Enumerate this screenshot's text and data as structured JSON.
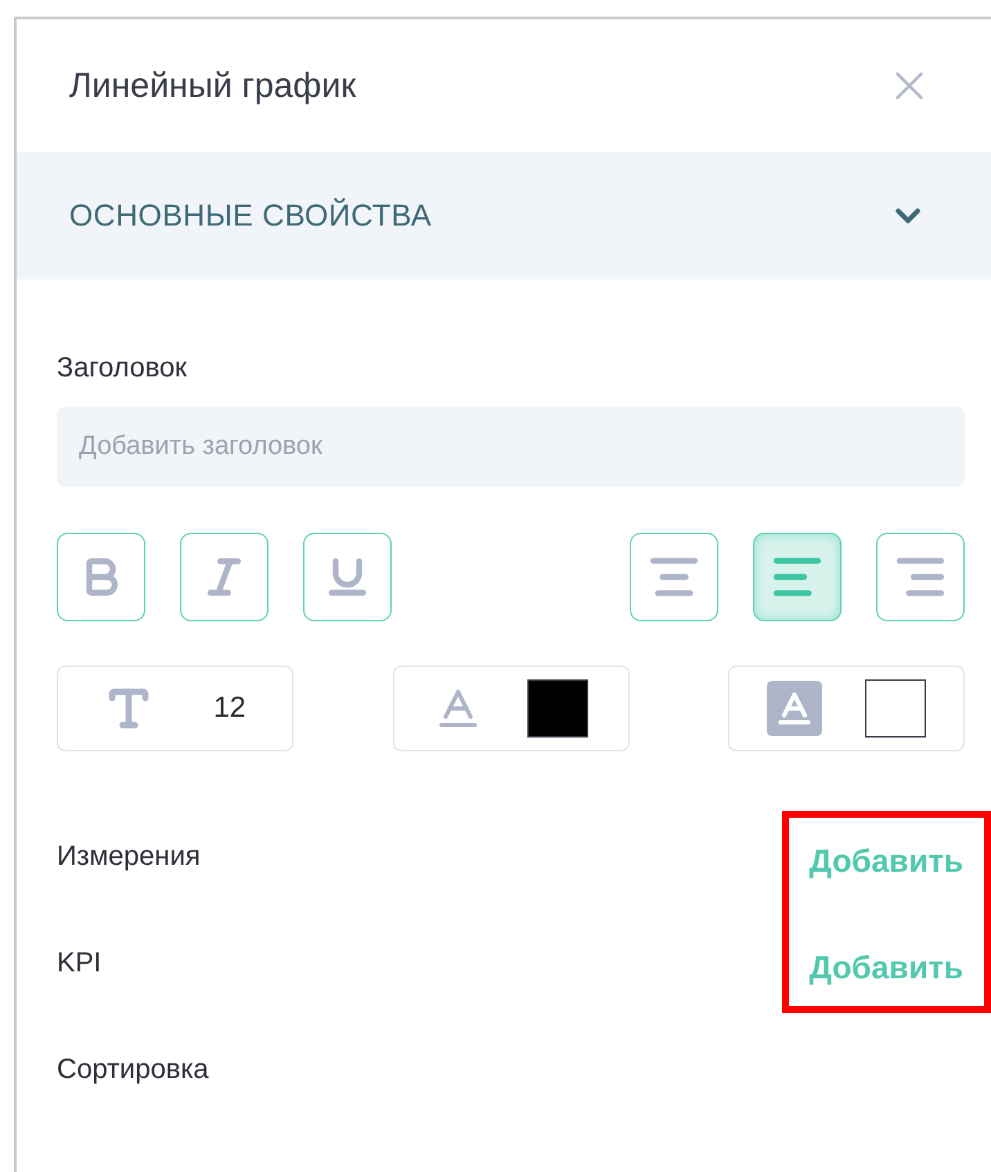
{
  "panel": {
    "title": "Линейный график"
  },
  "section": {
    "title": "ОСНОВНЫЕ СВОЙСТВА",
    "expanded": true
  },
  "title_field": {
    "label": "Заголовок",
    "placeholder": "Добавить заголовок"
  },
  "style_buttons": [
    {
      "kind": "bold",
      "selected": false
    },
    {
      "kind": "italic",
      "selected": false
    },
    {
      "kind": "underline",
      "selected": false
    }
  ],
  "align_buttons": [
    {
      "kind": "center",
      "selected": false
    },
    {
      "kind": "left",
      "selected": true
    },
    {
      "kind": "right",
      "selected": false
    }
  ],
  "font_size": {
    "value": "12"
  },
  "text_color": {
    "color": "#000000"
  },
  "background_color": {
    "color": "#ffffff"
  },
  "rows": [
    {
      "label": "Измерения",
      "action": "Добавить"
    },
    {
      "label": "KPI",
      "action": "Добавить"
    },
    {
      "label": "Сортировка"
    }
  ],
  "annotation": {
    "color": "#ff0000"
  }
}
